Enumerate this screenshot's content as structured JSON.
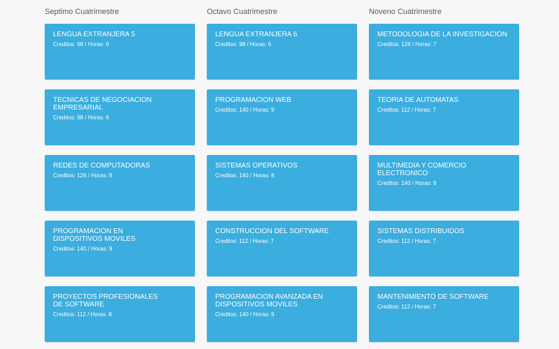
{
  "columns": [
    {
      "title": "Septimo Cuatrimestre",
      "courses": [
        {
          "name": "LENGUA EXTRANJERA 5",
          "meta": "Creditos: 98 / Horas: 6"
        },
        {
          "name": "TECNICAS DE NEGOCIACION EMPRESARIAL",
          "meta": "Creditos: 98 / Horas: 6"
        },
        {
          "name": "REDES DE COMPUTADORAS",
          "meta": "Creditos: 126 / Horas: 8"
        },
        {
          "name": "PROGRAMACION EN DISPOSITIVOS MOVILES",
          "meta": "Creditos: 140 / Horas: 9"
        },
        {
          "name": "PROYECTOS PROFESIONALES DE SOFTWARE",
          "meta": "Creditos: 112 / Horas: 8"
        }
      ]
    },
    {
      "title": "Octavo Cuatrimestre",
      "courses": [
        {
          "name": "LENGUA EXTRANJERA 6",
          "meta": "Creditos: 98 / Horas: 6"
        },
        {
          "name": "PROGRAMACION WEB",
          "meta": "Creditos: 140 / Horas: 9"
        },
        {
          "name": "SISTEMAS OPERATIVOS",
          "meta": "Creditos: 140 / Horas: 8"
        },
        {
          "name": "CONSTRUCCION DEL SOFTWARE",
          "meta": "Creditos: 112 / Horas: 7"
        },
        {
          "name": "PROGRAMACION AVANZADA EN DISPOSITIVOS MOVILES",
          "meta": "Creditos: 140 / Horas: 9"
        }
      ]
    },
    {
      "title": "Noveno Cuatrimestre",
      "courses": [
        {
          "name": "METODOLOGIA DE LA INVESTIGACION",
          "meta": "Creditos: 126 / Horas: 7"
        },
        {
          "name": "TEORIA DE AUTOMATAS",
          "meta": "Creditos: 112 / Horas: 7"
        },
        {
          "name": "MULTIMEDIA Y COMERCIO ELECTRONICO",
          "meta": "Creditos: 140 / Horas: 9"
        },
        {
          "name": "SISTEMAS DISTRIBUIDOS",
          "meta": "Creditos: 112 / Horas: 7"
        },
        {
          "name": "MANTENIMIENTO DE SOFTWARE",
          "meta": "Creditos: 112 / Horas: 7"
        }
      ]
    }
  ],
  "colors": {
    "card": "#3badde",
    "card_text": "#ffffff",
    "heading": "#5a5a5a",
    "background": "#f7f7f7"
  }
}
